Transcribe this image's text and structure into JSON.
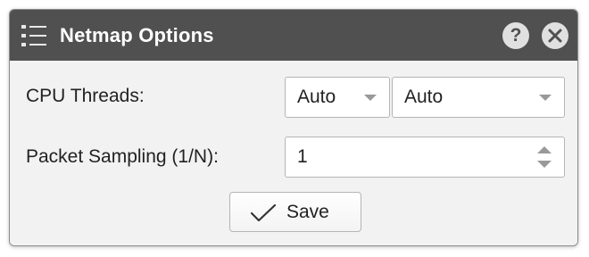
{
  "dialog": {
    "title": "Netmap Options",
    "title_icon": "list-icon",
    "help_label": "?",
    "help_icon": "help-icon",
    "close_icon": "close-icon"
  },
  "form": {
    "cpu_threads": {
      "label": "CPU Threads:",
      "select_primary_value": "Auto",
      "select_secondary_value": "Auto"
    },
    "packet_sampling": {
      "label": "Packet Sampling (1/N):",
      "value": "1"
    }
  },
  "actions": {
    "save_label": "Save",
    "save_icon": "checkmark-icon"
  },
  "colors": {
    "titlebar": "#505050",
    "body": "#f2f2f2",
    "title_text": "#ffffff"
  }
}
